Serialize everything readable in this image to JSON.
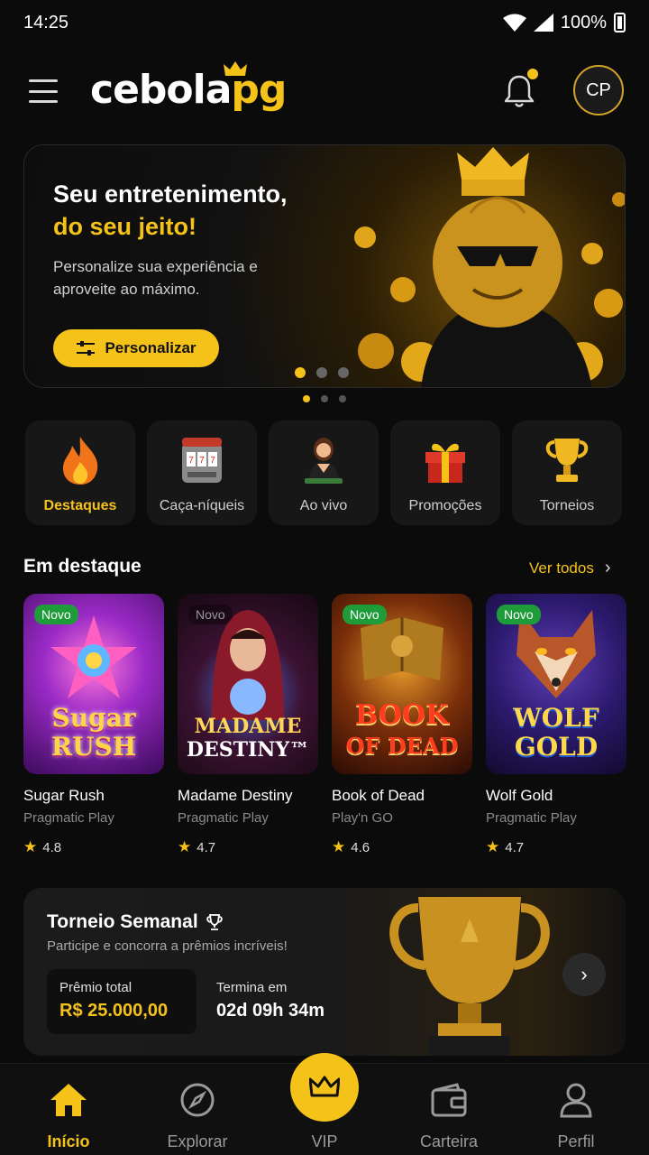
{
  "status_bar": {
    "time": "14:25",
    "battery": "100%"
  },
  "header": {
    "logo_part1": "cebola",
    "logo_part2": "pg",
    "avatar_initials": "CP",
    "colors": {
      "accent": "#f5c21a"
    }
  },
  "hero": {
    "title_line1": "Seu entretenimento,",
    "title_line2": "do seu jeito!",
    "subtitle": "Personalize sua experiência e aproveite ao máximo.",
    "button_label": "Personalizar"
  },
  "categories": [
    {
      "label": "Destaques",
      "icon": "fire-icon",
      "active": true
    },
    {
      "label": "Caça-níqueis",
      "icon": "slot-machine-icon",
      "active": false
    },
    {
      "label": "Ao vivo",
      "icon": "live-dealer-icon",
      "active": false
    },
    {
      "label": "Promoções",
      "icon": "gift-icon",
      "active": false
    },
    {
      "label": "Torneios",
      "icon": "trophy-icon",
      "active": false
    }
  ],
  "featured": {
    "title": "Em destaque",
    "see_all": "Ver todos",
    "games": [
      {
        "name": "Sugar Rush",
        "provider": "Pragmatic Play",
        "rating": "4.8",
        "badge": "Novo",
        "cover_line1": "Sugar",
        "cover_line2": "RUSH"
      },
      {
        "name": "Madame Destiny",
        "provider": "Pragmatic Play",
        "rating": "4.7",
        "badge": "Novo",
        "cover_line1": "MADAME",
        "cover_line2": "DESTINY™"
      },
      {
        "name": "Book of Dead",
        "provider": "Play'n GO",
        "rating": "4.6",
        "badge": "Novo",
        "cover_line1": "BOOK",
        "cover_line2": "OF DEAD"
      },
      {
        "name": "Wolf Gold",
        "provider": "Pragmatic Play",
        "rating": "4.7",
        "badge": "Novo",
        "cover_line1": "WOLF",
        "cover_line2": "GOLD"
      }
    ]
  },
  "tournament": {
    "title": "Torneio Semanal",
    "subtitle": "Participe e concorra a prêmios incríveis!",
    "prize_label": "Prêmio total",
    "prize_value": "R$ 25.000,00",
    "ends_label": "Termina em",
    "ends_value": "02d 09h 34m"
  },
  "bottom_nav": [
    {
      "label": "Início",
      "icon": "home-icon",
      "active": true
    },
    {
      "label": "Explorar",
      "icon": "compass-icon",
      "active": false
    },
    {
      "label": "VIP",
      "icon": "crown-icon",
      "active": false
    },
    {
      "label": "Carteira",
      "icon": "wallet-icon",
      "active": false
    },
    {
      "label": "Perfil",
      "icon": "user-icon",
      "active": false
    }
  ]
}
